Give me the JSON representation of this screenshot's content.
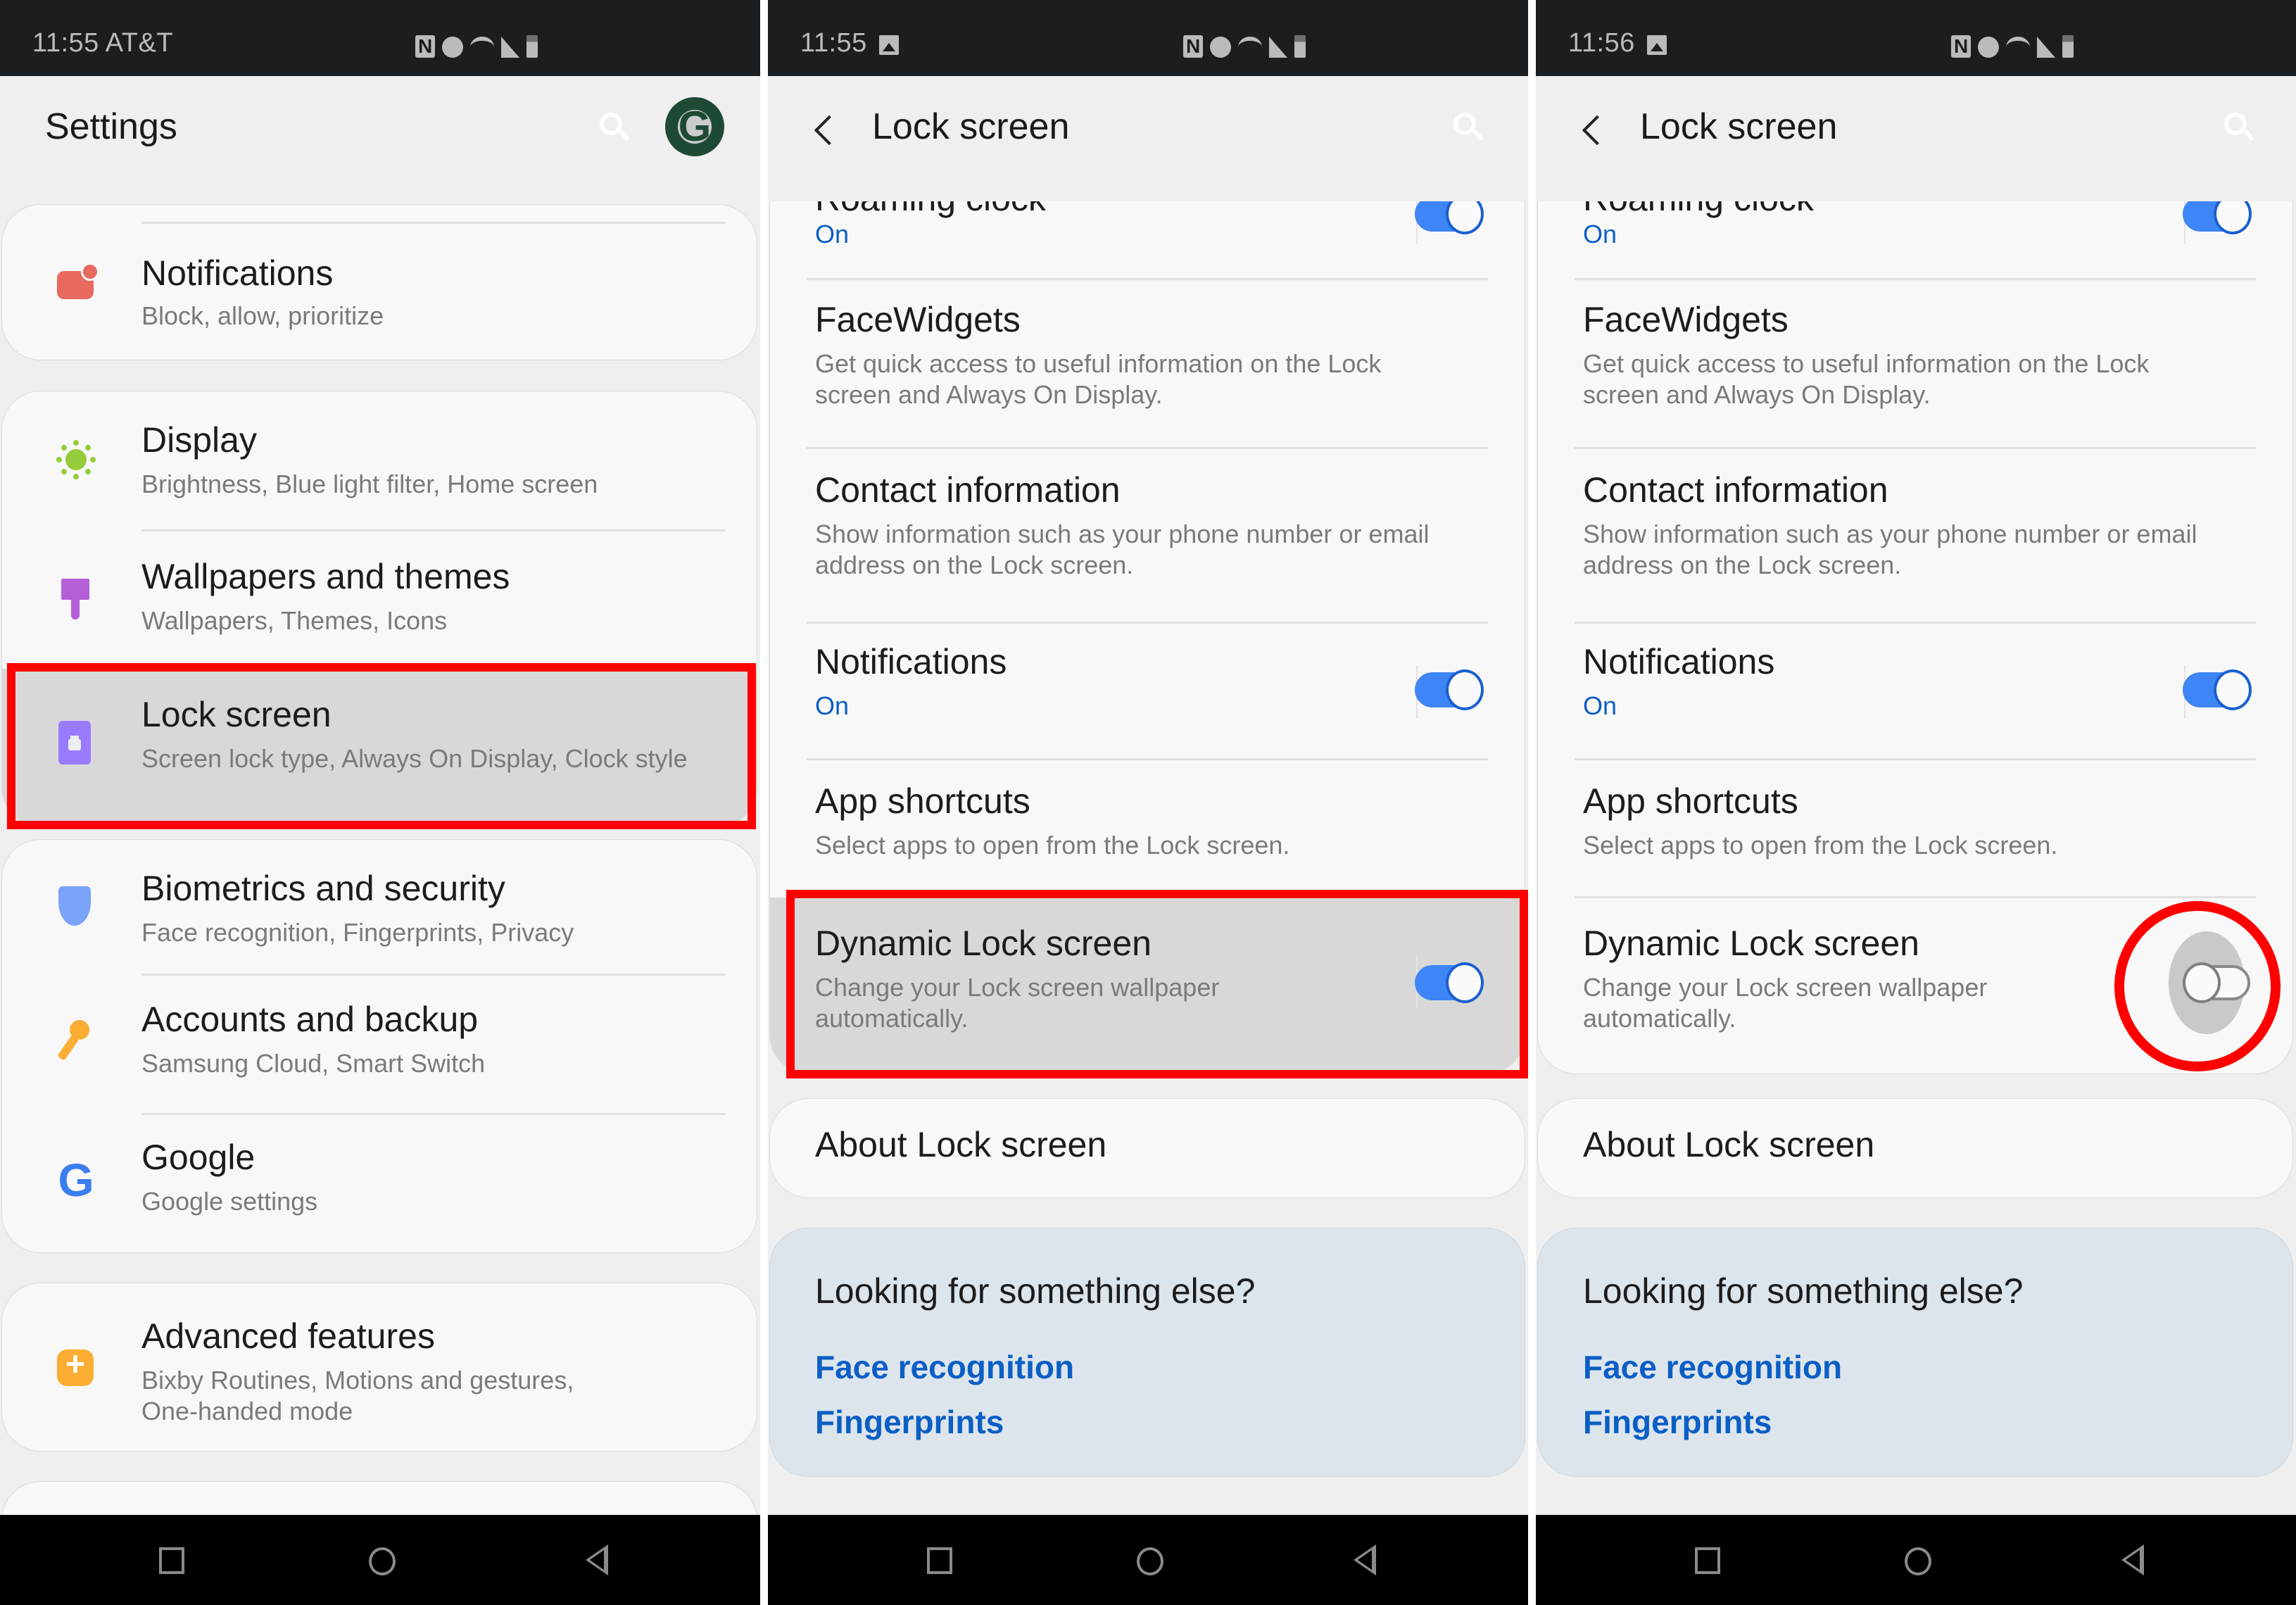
{
  "panels": [
    {
      "status_bar": {
        "time": "11:55 AT&T",
        "icons": [
          "nfc-icon",
          "alarm-icon",
          "wifi-icon",
          "signal-icon",
          "battery-icon"
        ]
      },
      "header": {
        "title": "Settings",
        "search_icon": "search-icon",
        "avatar": "profile-avatar"
      },
      "cards": [
        {
          "items": [
            {
              "icon": "notifications-icon",
              "title": "Notifications",
              "subtitle": "Block, allow, prioritize"
            }
          ]
        },
        {
          "items": [
            {
              "icon": "display-sun-icon",
              "title": "Display",
              "subtitle": "Brightness, Blue light filter, Home screen"
            },
            {
              "icon": "paintbrush-icon",
              "title": "Wallpapers and themes",
              "subtitle": "Wallpapers, Themes, Icons"
            },
            {
              "icon": "lock-icon",
              "title": "Lock screen",
              "subtitle": "Screen lock type, Always On Display, Clock style",
              "highlighted": true
            }
          ]
        },
        {
          "items": [
            {
              "icon": "shield-icon",
              "title": "Biometrics and security",
              "subtitle": "Face recognition, Fingerprints, Privacy"
            },
            {
              "icon": "key-icon",
              "title": "Accounts and backup",
              "subtitle": "Samsung Cloud, Smart Switch"
            },
            {
              "icon": "google-g-icon",
              "title": "Google",
              "subtitle": "Google settings"
            }
          ]
        },
        {
          "items": [
            {
              "icon": "advanced-gear-icon",
              "title": "Advanced features",
              "subtitle_line1": "Bixby Routines, Motions and gestures,",
              "subtitle_line2": "One-handed mode"
            }
          ]
        }
      ],
      "annotation": "red-box-around-lock-screen"
    },
    {
      "status_bar": {
        "time": "11:55"
      },
      "header": {
        "title": "Lock screen"
      },
      "items": {
        "roaming": {
          "title": "Roaming clock",
          "status": "On",
          "toggle_on": true
        },
        "facewidgets": {
          "title": "FaceWidgets",
          "line1": "Get quick access to useful information on the Lock",
          "line2": "screen and Always On Display."
        },
        "contact": {
          "title": "Contact information",
          "line1": "Show information such as your phone number or email",
          "line2": "address on the Lock screen."
        },
        "notifications": {
          "title": "Notifications",
          "status": "On",
          "toggle_on": true
        },
        "app_shortcuts": {
          "title": "App shortcuts",
          "line1": "Select apps to open from the Lock screen."
        },
        "dynamic": {
          "title": "Dynamic Lock screen",
          "line1": "Change your Lock screen wallpaper",
          "line2": "automatically.",
          "toggle_on": true
        }
      },
      "about": "About Lock screen",
      "looking": {
        "title": "Looking for something else?",
        "links": [
          "Face recognition",
          "Fingerprints"
        ]
      },
      "annotation": "red-box-around-dynamic-lock-screen"
    },
    {
      "status_bar": {
        "time": "11:56"
      },
      "header": {
        "title": "Lock screen"
      },
      "items": {
        "roaming": {
          "title": "Roaming clock",
          "status": "On",
          "toggle_on": true
        },
        "facewidgets": {
          "title": "FaceWidgets",
          "line1": "Get quick access to useful information on the Lock",
          "line2": "screen and Always On Display."
        },
        "contact": {
          "title": "Contact information",
          "line1": "Show information such as your phone number or email",
          "line2": "address on the Lock screen."
        },
        "notifications": {
          "title": "Notifications",
          "status": "On",
          "toggle_on": true
        },
        "app_shortcuts": {
          "title": "App shortcuts",
          "line1": "Select apps to open from the Lock screen."
        },
        "dynamic": {
          "title": "Dynamic Lock screen",
          "line1": "Change your Lock screen wallpaper",
          "line2": "automatically.",
          "toggle_on": false
        }
      },
      "about": "About Lock screen",
      "looking": {
        "title": "Looking for something else?",
        "links": [
          "Face recognition",
          "Fingerprints"
        ]
      },
      "annotation": "red-circle-around-dynamic-toggle"
    }
  ],
  "colors": {
    "accent": "#3e85f7",
    "link": "#0b5ec5",
    "annotation": "#ff0000",
    "status_bar": "#1b1e21"
  }
}
